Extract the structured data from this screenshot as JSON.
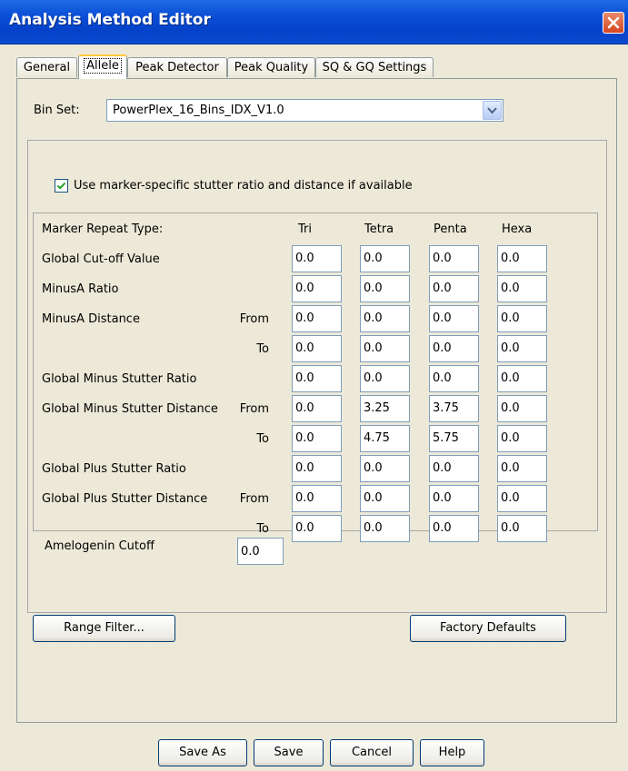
{
  "window": {
    "title": "Analysis Method Editor"
  },
  "tabs": [
    "General",
    "Allele",
    "Peak Detector",
    "Peak Quality",
    "SQ & GQ Settings"
  ],
  "bin_set": {
    "label": "Bin Set:",
    "value": "PowerPlex_16_Bins_IDX_V1.0"
  },
  "use_marker_specific": {
    "label": "Use marker-specific stutter ratio and distance if available",
    "checked": true
  },
  "grid": {
    "header_label": "Marker Repeat Type:",
    "columns": [
      "Tri",
      "Tetra",
      "Penta",
      "Hexa"
    ],
    "rows": [
      {
        "label": "Global Cut-off Value",
        "sub": "",
        "values": [
          "0.0",
          "0.0",
          "0.0",
          "0.0"
        ]
      },
      {
        "label": "MinusA Ratio",
        "sub": "",
        "values": [
          "0.0",
          "0.0",
          "0.0",
          "0.0"
        ]
      },
      {
        "label": "MinusA Distance",
        "sub": "From",
        "values": [
          "0.0",
          "0.0",
          "0.0",
          "0.0"
        ]
      },
      {
        "label": "",
        "sub": "To",
        "values": [
          "0.0",
          "0.0",
          "0.0",
          "0.0"
        ]
      },
      {
        "label": "Global Minus Stutter Ratio",
        "sub": "",
        "values": [
          "0.0",
          "0.0",
          "0.0",
          "0.0"
        ]
      },
      {
        "label": "Global Minus Stutter Distance",
        "sub": "From",
        "values": [
          "0.0",
          "3.25",
          "3.75",
          "0.0"
        ]
      },
      {
        "label": "",
        "sub": "To",
        "values": [
          "0.0",
          "4.75",
          "5.75",
          "0.0"
        ]
      },
      {
        "label": "Global Plus Stutter Ratio",
        "sub": "",
        "values": [
          "0.0",
          "0.0",
          "0.0",
          "0.0"
        ]
      },
      {
        "label": "Global Plus Stutter Distance",
        "sub": "From",
        "values": [
          "0.0",
          "0.0",
          "0.0",
          "0.0"
        ]
      },
      {
        "label": "",
        "sub": "To",
        "values": [
          "0.0",
          "0.0",
          "0.0",
          "0.0"
        ]
      }
    ]
  },
  "amelogenin": {
    "label": "Amelogenin Cutoff",
    "value": "0.0"
  },
  "buttons": {
    "range_filter": "Range Filter...",
    "factory_defaults": "Factory Defaults",
    "save_as": "Save As",
    "save": "Save",
    "cancel": "Cancel",
    "help": "Help"
  },
  "colors": {
    "titlebar": "#0542c9",
    "window_bg": "#ece9d8",
    "active_tab_accent": "#ffc83c",
    "close_button": "#d6461e"
  },
  "icons": {
    "close": "close-icon",
    "dropdown": "chevron-down-icon",
    "check": "checkmark-icon"
  }
}
